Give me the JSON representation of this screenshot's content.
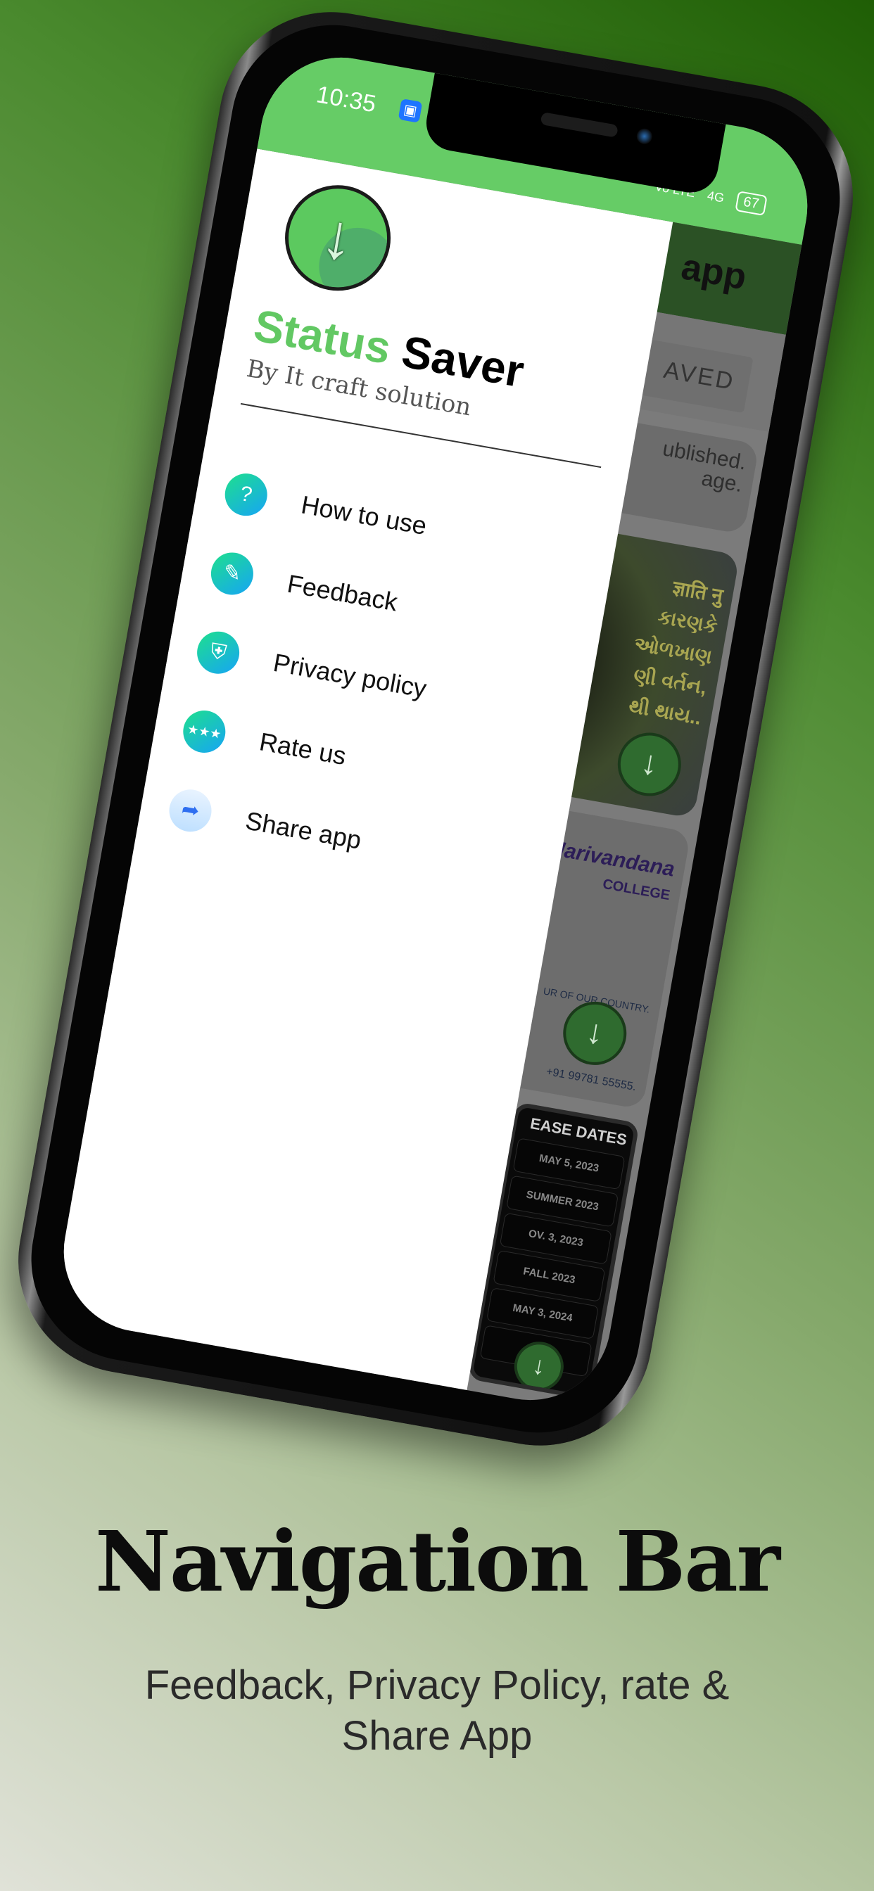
{
  "status_bar": {
    "time": "10:35",
    "network": "Vo LTE",
    "signal": "4G",
    "battery": "67"
  },
  "app": {
    "toolbar_title_visible": "app",
    "tab_visible": "AVED",
    "notice_line1": "ublished.",
    "notice_line2": "age.",
    "card1_text": [
      "ज्ञाति नु",
      "કારણકે",
      "ઓળખાણ",
      "ણી વર્તન,",
      "થી થાય.."
    ],
    "card2": {
      "college": "Harivandana",
      "college_sub": "COLLEGE",
      "phone": "+91 99781 55555.",
      "line": "UR OF OUR COUNTRY."
    },
    "card3": {
      "title": "EASE DATES",
      "items": [
        "MAY 5, 2023",
        "SUMMER 2023",
        "OV. 3, 2023",
        "FALL 2023",
        "MAY 3, 2024",
        ""
      ]
    }
  },
  "drawer": {
    "title_green": "Status",
    "title_black": "Saver",
    "subtitle": "By It craft solution",
    "items": [
      {
        "label": "How to use",
        "icon": "help-book-icon"
      },
      {
        "label": "Feedback",
        "icon": "clipboard-edit-icon"
      },
      {
        "label": "Privacy policy",
        "icon": "shield-wrench-icon"
      },
      {
        "label": "Rate us",
        "icon": "user-stars-icon"
      },
      {
        "label": "Share app",
        "icon": "share-arrow-icon"
      }
    ]
  },
  "promo": {
    "headline": "Navigation Bar",
    "subtitle_line1": "Feedback, Privacy Policy, rate &",
    "subtitle_line2": "Share App"
  },
  "colors": {
    "status_green": "#66cc66",
    "title_green": "#62c863",
    "toolbar": "#2b5125"
  }
}
